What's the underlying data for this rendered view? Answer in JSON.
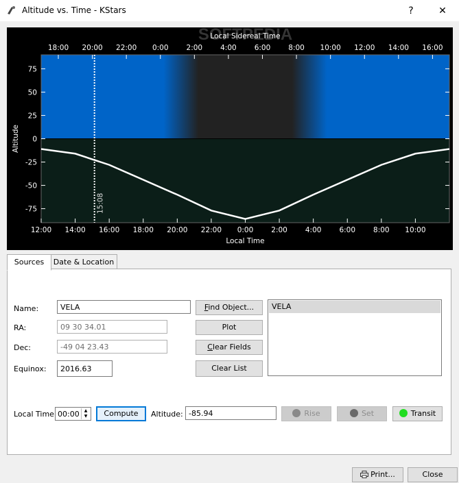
{
  "window": {
    "title": "Altitude vs. Time - KStars",
    "help_label": "?",
    "close_label": "✕"
  },
  "plot": {
    "top_axis_title": "Local Sidereal Time",
    "bottom_axis_title": "Local Time",
    "left_axis_title": "Altitude",
    "top_ticks": [
      "18:00",
      "20:00",
      "22:00",
      "0:00",
      "2:00",
      "4:00",
      "6:00",
      "8:00",
      "10:00",
      "12:00",
      "14:00",
      "16:00"
    ],
    "bottom_ticks": [
      "12:00",
      "14:00",
      "16:00",
      "18:00",
      "20:00",
      "22:00",
      "0:00",
      "2:00",
      "4:00",
      "6:00",
      "8:00",
      "10:00"
    ],
    "y_ticks": [
      "75",
      "50",
      "25",
      "0",
      "-25",
      "-50",
      "-75"
    ],
    "cursor_label": "15:08",
    "watermark": "SOFTPEDIA",
    "colors": {
      "day_sky": "#0064c8",
      "night_sky": "#222222",
      "ground": "#0b1e18",
      "curve": "#ffffff"
    }
  },
  "chart_data": {
    "type": "line",
    "xlabel": "Local Time",
    "ylabel": "Altitude",
    "ylim": [
      -90,
      90
    ],
    "x_range_hours": [
      12,
      36
    ],
    "cursor_time": "15:08",
    "series": [
      {
        "name": "VELA",
        "x": [
          "12:00",
          "14:00",
          "16:00",
          "18:00",
          "20:00",
          "22:00",
          "0:00",
          "2:00",
          "4:00",
          "6:00",
          "8:00",
          "10:00",
          "12:00"
        ],
        "values": [
          -11,
          -16,
          -28,
          -44,
          -60,
          -77,
          -86,
          -77,
          -60,
          -44,
          -28,
          -16,
          -11
        ]
      }
    ]
  },
  "tabs": [
    {
      "label": "Sources"
    },
    {
      "label": "Date & Location"
    }
  ],
  "form": {
    "name_label": "Name:",
    "name_value": "VELA",
    "ra_label": "RA:",
    "ra_value": "09 30 34.01",
    "dec_label": "Dec:",
    "dec_value": "-49 04 23.43",
    "equinox_label": "Equinox:",
    "equinox_value": "2016.63",
    "find_object": "Find Object...",
    "plot": "Plot",
    "clear_fields": "Clear Fields",
    "clear_list": "Clear List"
  },
  "source_list": [
    "VELA"
  ],
  "bottom_row": {
    "local_time_label": "Local Time:",
    "local_time_value": "00:00",
    "compute": "Compute",
    "altitude_label": "Altitude:",
    "altitude_value": "-85.94",
    "rise": "Rise",
    "set": "Set",
    "transit": "Transit"
  },
  "footer": {
    "print": "Print...",
    "close": "Close"
  }
}
